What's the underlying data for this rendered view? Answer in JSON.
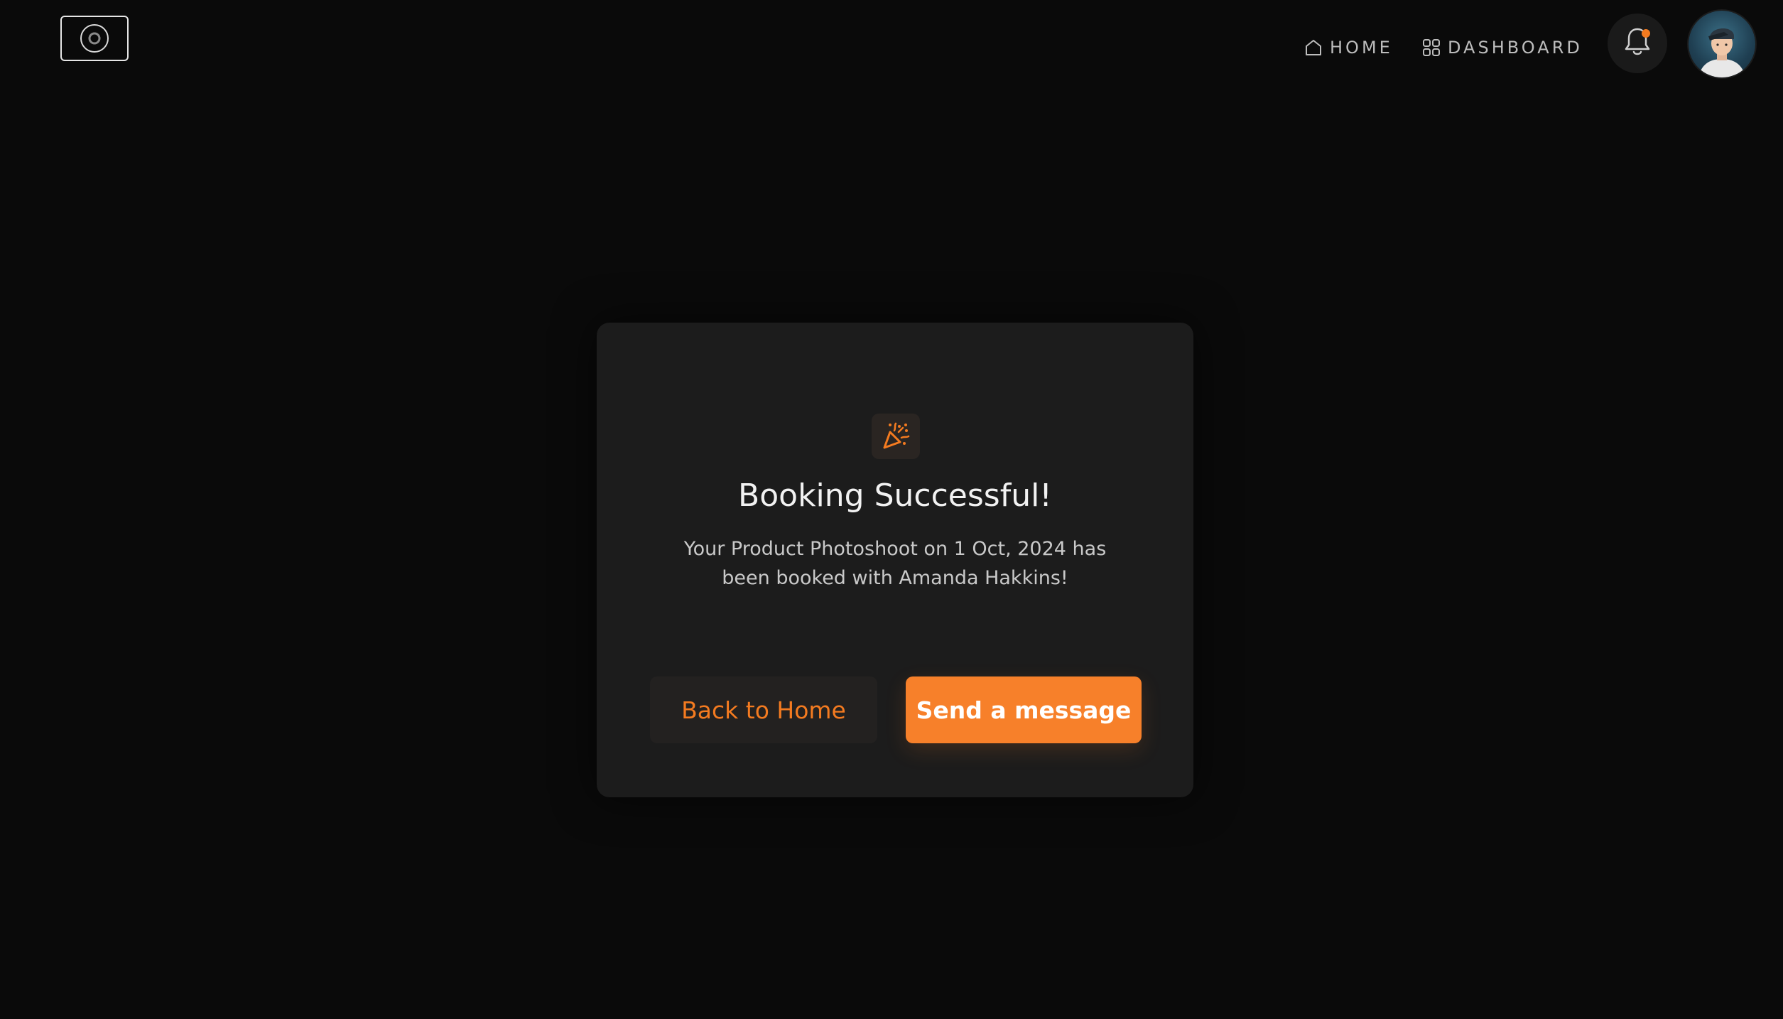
{
  "header": {
    "logo_icon": "camera-lens-icon",
    "nav": [
      {
        "label": "HOME",
        "icon": "home-icon"
      },
      {
        "label": "DASHBOARD",
        "icon": "grid-icon"
      }
    ],
    "notifications": {
      "icon": "bell-icon",
      "has_unread": true
    },
    "avatar_icon": "user-avatar"
  },
  "card": {
    "icon": "party-popper-icon",
    "title": "Booking Successful!",
    "message": "Your Product Photoshoot on 1 Oct, 2024 has been booked with Amanda Hakkins!",
    "buttons": {
      "back_label": "Back to Home",
      "send_label": "Send a message"
    }
  },
  "colors": {
    "background": "#0a0a0a",
    "card": "#1c1c1c",
    "accent": "#f47b20"
  }
}
